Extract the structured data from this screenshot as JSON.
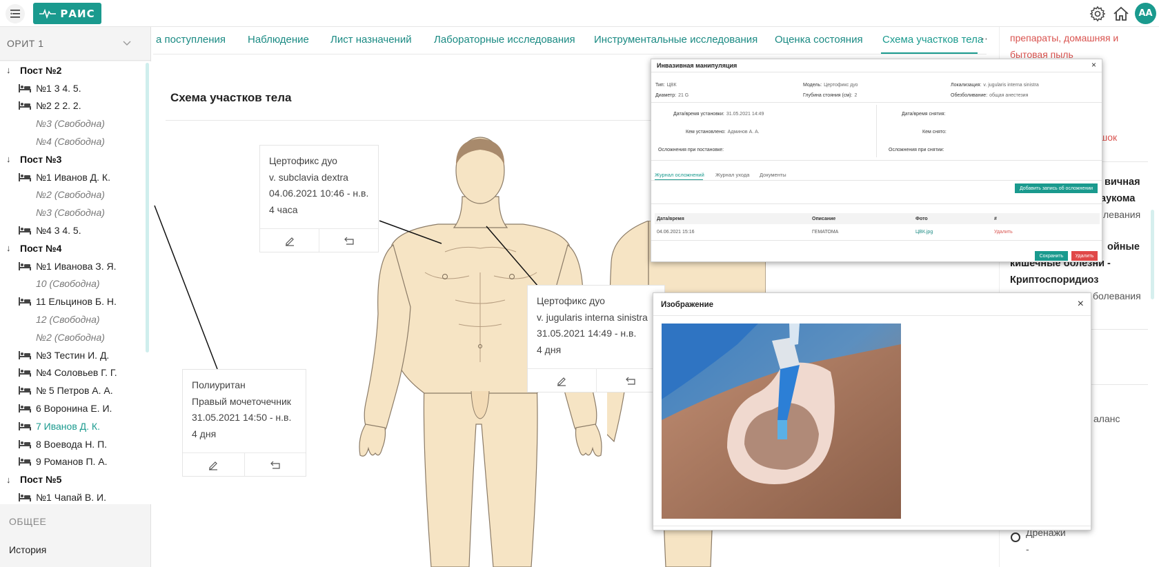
{
  "header": {
    "logo_text": "РАИС",
    "avatar": "AA"
  },
  "sidebar": {
    "department": "ОРИТ 1",
    "tree": [
      {
        "kind": "post",
        "label": "Пост №2"
      },
      {
        "kind": "bed",
        "label": "№1 3 4. 5."
      },
      {
        "kind": "bed",
        "label": "№2 2 2. 2."
      },
      {
        "kind": "free",
        "label": "№3 (Свободна)"
      },
      {
        "kind": "free",
        "label": "№4 (Свободна)"
      },
      {
        "kind": "post",
        "label": "Пост №3"
      },
      {
        "kind": "bed",
        "label": "№1 Иванов Д. К."
      },
      {
        "kind": "free",
        "label": "№2 (Свободна)"
      },
      {
        "kind": "free",
        "label": "№3 (Свободна)"
      },
      {
        "kind": "bed",
        "label": "№4 3 4. 5."
      },
      {
        "kind": "post",
        "label": "Пост №4"
      },
      {
        "kind": "bed",
        "label": "№1 Иванова З. Я."
      },
      {
        "kind": "free",
        "label": "10 (Свободна)"
      },
      {
        "kind": "bed",
        "label": "11 Ельцинов Б. Н."
      },
      {
        "kind": "free",
        "label": "12 (Свободна)"
      },
      {
        "kind": "free",
        "label": "№2 (Свободна)"
      },
      {
        "kind": "bed",
        "label": "№3 Тестин И. Д."
      },
      {
        "kind": "bed",
        "label": "№4 Соловьев Г. Г."
      },
      {
        "kind": "bed",
        "label": "№ 5 Петров А. А."
      },
      {
        "kind": "bed",
        "label": "6 Воронина Е. И."
      },
      {
        "kind": "bed",
        "label": "7 Иванов Д. К.",
        "active": true
      },
      {
        "kind": "bed",
        "label": "8 Воевода Н. П."
      },
      {
        "kind": "bed",
        "label": "9 Романов П. А."
      },
      {
        "kind": "post",
        "label": "Пост №5"
      },
      {
        "kind": "bed",
        "label": "№1 Чапай В. И."
      }
    ],
    "section_general": "ОБЩЕЕ",
    "history": "История"
  },
  "tabs": [
    {
      "label": "а поступления"
    },
    {
      "label": "Наблюдение"
    },
    {
      "label": "Лист назначений"
    },
    {
      "label": "Лабораторные исследования"
    },
    {
      "label": "Инструментальные исследования"
    },
    {
      "label": "Оценка состояния"
    },
    {
      "label": "Схема участков тела",
      "active": true
    }
  ],
  "more": "···",
  "page_title": "Схема участков тела",
  "cards": [
    {
      "l1": "Цертофикс дуо",
      "l2": "v. subclavia dextra",
      "l3": "04.06.2021 10:46 - н.в.",
      "l4": "4 часа"
    },
    {
      "l1": "Цертофикс дуо",
      "l2": "v. jugularis interna sinistra",
      "l3": "31.05.2021 14:49 - н.в.",
      "l4": "4 дня"
    },
    {
      "l1": "Полиуритан",
      "l2": "Правый мочеточечник",
      "l3": "31.05.2021 14:50 - н.в.",
      "l4": "4 дня"
    }
  ],
  "right_panel": {
    "r1": "препараты, домашняя и",
    "r2": "бытовая пыль",
    "r3": "шок",
    "r4": "вичная",
    "r5": "аукома",
    "r6": "левания",
    "r7": "ойные",
    "r8": "кишечные болезни -",
    "r9": "Криптоспоридиоз",
    "r10": "болевания",
    "r11": "аланс",
    "r12": "Дренажи",
    "r13": "-"
  },
  "modal1": {
    "title": "Инвазивная манипуляция",
    "type_label": "Тип:",
    "type_value": "ЦВК",
    "model_label": "Модель:",
    "model_value": "Цертофикс дуо",
    "loc_label": "Локализация:",
    "loc_value": "v. jugularis interna sinistra",
    "diam_label": "Диаметр:",
    "diam_value": "21 G",
    "depth_label": "Глубина стояния (см):",
    "depth_value": "2",
    "anest_label": "Обезболивание:",
    "anest_value": "общая анестезия",
    "set_dt_label": "Дата/время установки:",
    "set_dt_value": "31.05.2021 14:49",
    "rem_dt_label": "Дата/время снятия:",
    "set_by_label": "Кем установлено:",
    "set_by_value": "Админов А. А.",
    "rem_by_label": "Кем снято:",
    "compl_set_label": "Осложнения при постановке:",
    "compl_rem_label": "Осложнения при снятии:",
    "tabs": [
      "Журнал осложнений",
      "Журнал ухода",
      "Документы"
    ],
    "add_btn": "Добавить запись об осложнении",
    "th": [
      "Дата/время",
      "Описание",
      "Фото",
      "#"
    ],
    "row": {
      "dt": "04.06.2021 15:16",
      "desc": "ГЕМАТОМА",
      "photo": "ЦВК.jpg",
      "action": "Удалить"
    },
    "save": "Сохранить",
    "delete": "Удалить"
  },
  "modal2": {
    "title": "Изображение"
  }
}
